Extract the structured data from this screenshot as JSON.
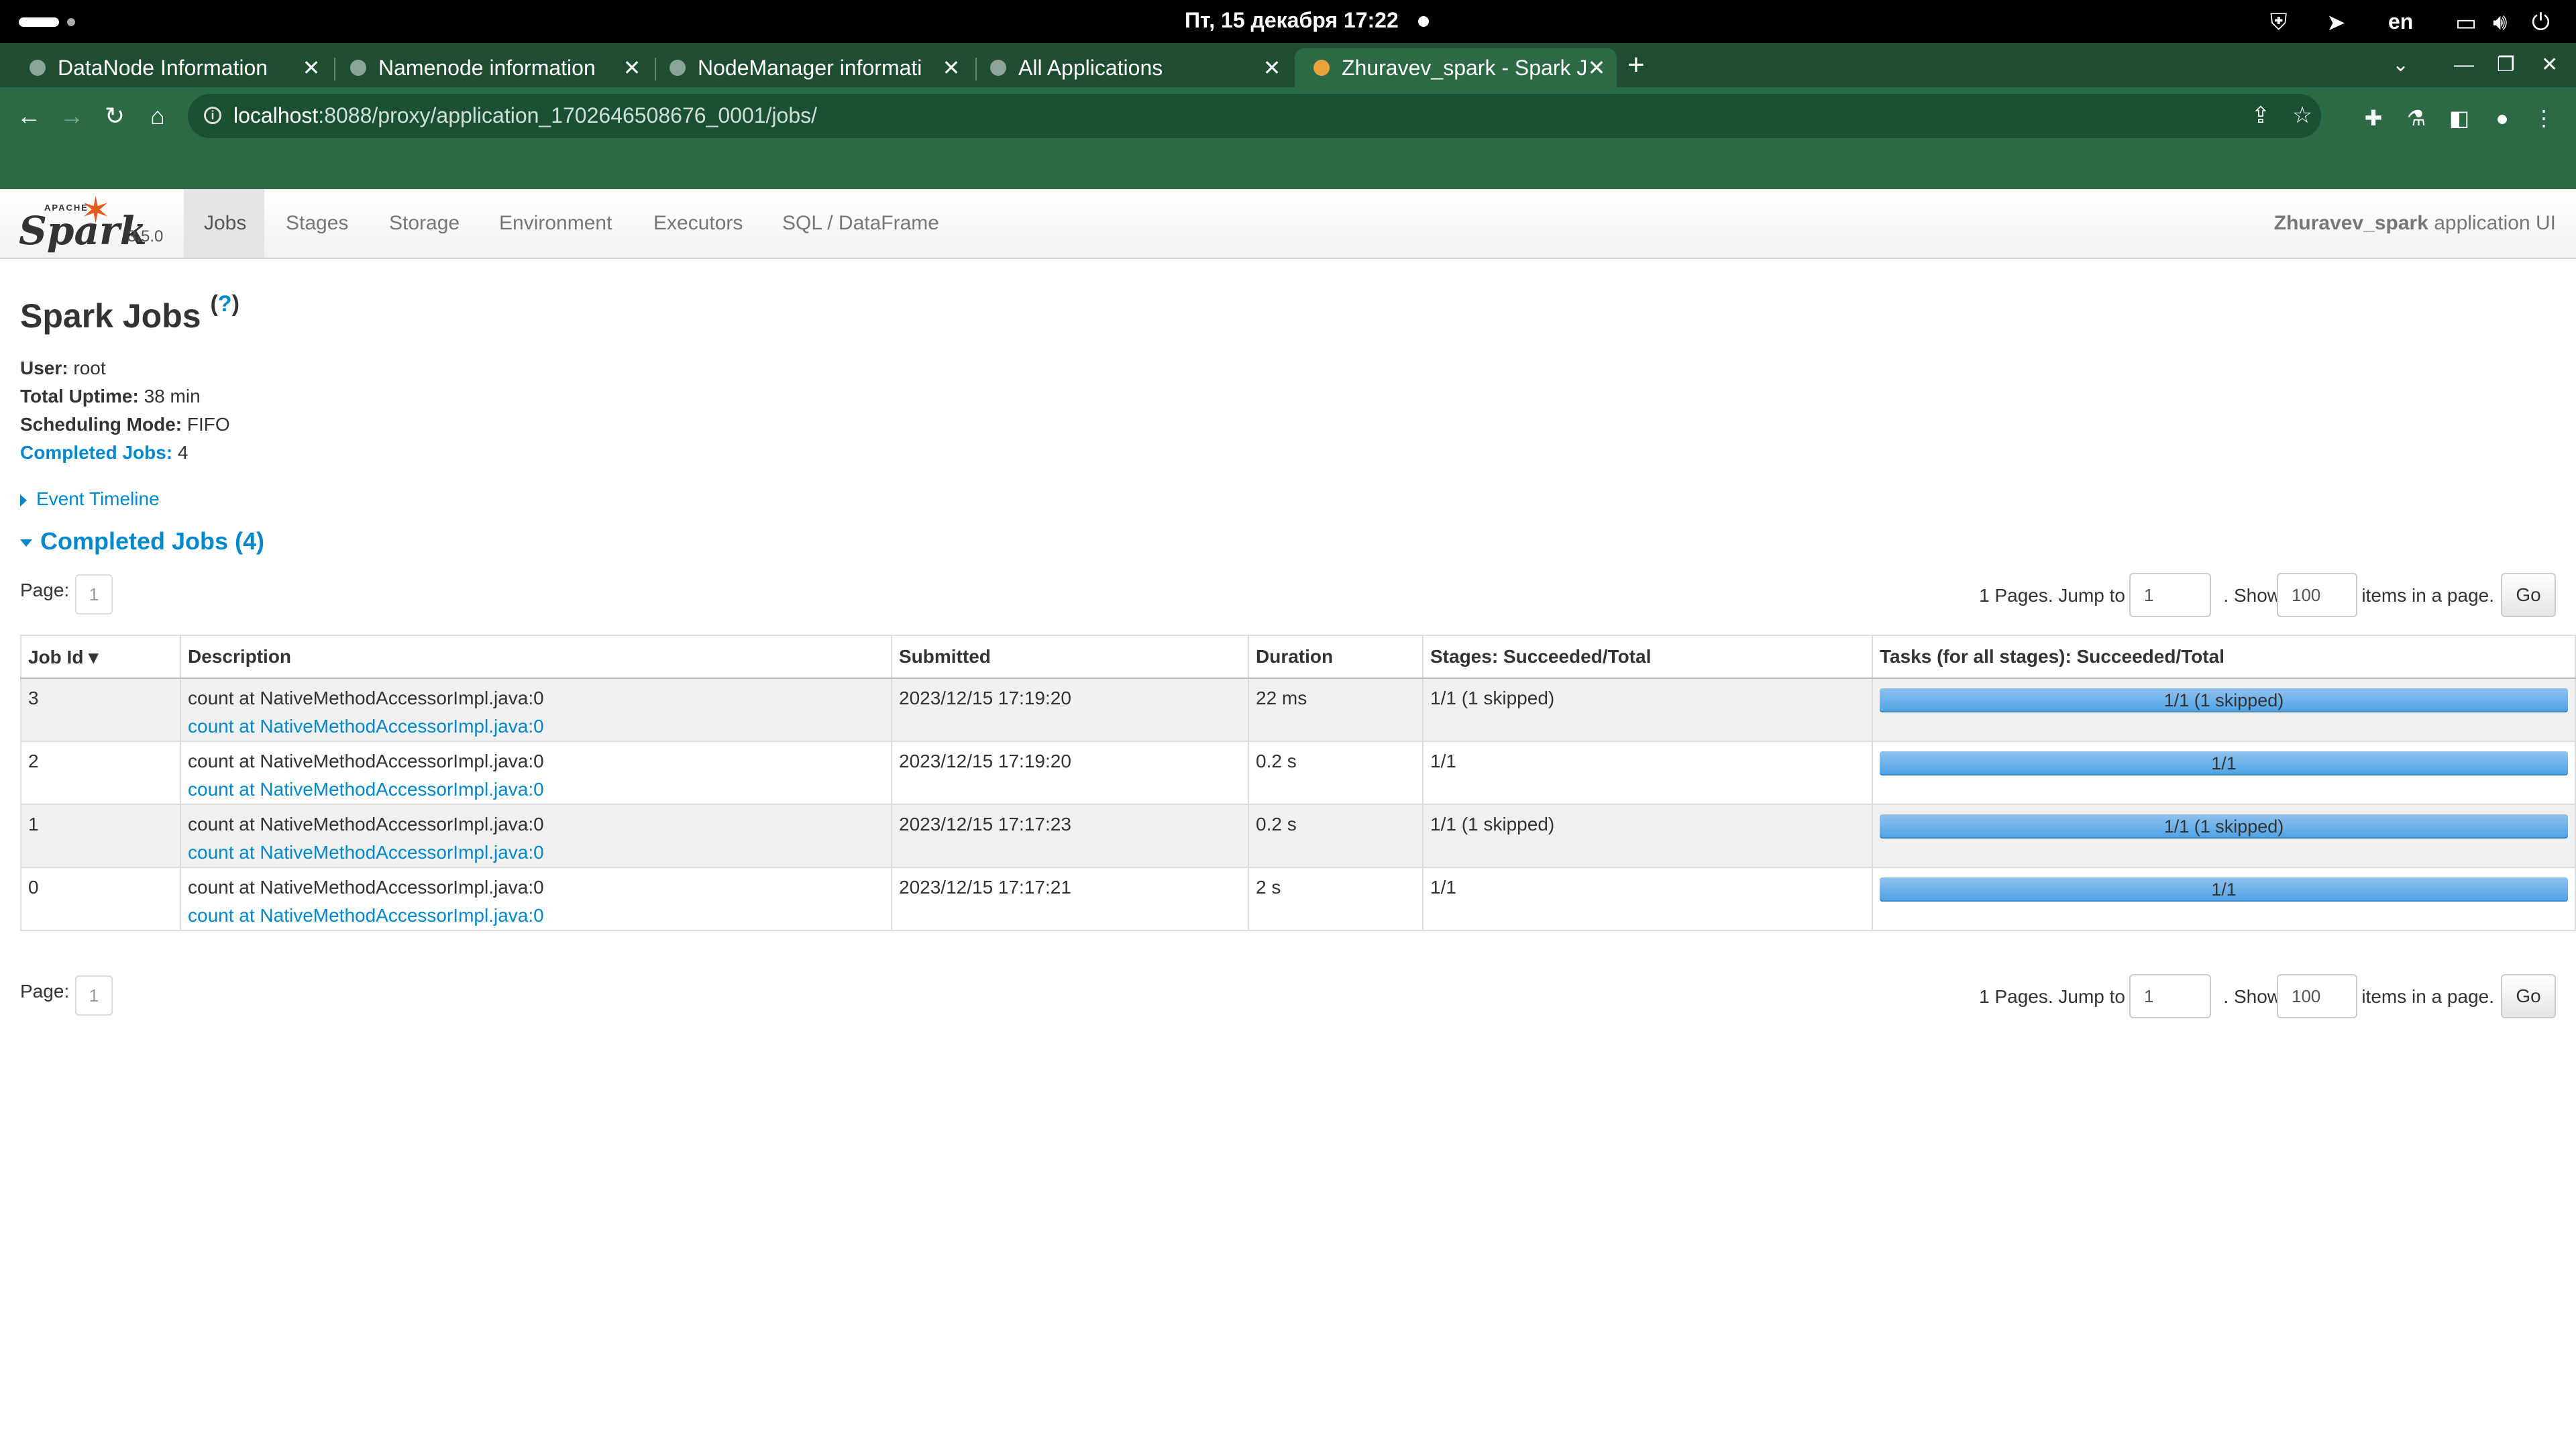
{
  "system_bar": {
    "clock": "Пт, 15 декабря  17:22",
    "lang": "en"
  },
  "browser": {
    "tabs": [
      {
        "title": "DataNode Information"
      },
      {
        "title": "Namenode information"
      },
      {
        "title": "NodeManager informati"
      },
      {
        "title": "All Applications"
      },
      {
        "title": "Zhuravev_spark - Spark J"
      }
    ],
    "url_host": "localhost",
    "url_rest": ":8088/proxy/application_1702646508676_0001/jobs/"
  },
  "spark_nav": {
    "logo_apache": "APACHE",
    "logo_word": "Spark",
    "version": "3.5.0",
    "items": [
      "Jobs",
      "Stages",
      "Storage",
      "Environment",
      "Executors",
      "SQL / DataFrame"
    ],
    "app_name": "Zhuravev_spark",
    "app_suffix": " application UI"
  },
  "page": {
    "title": "Spark Jobs",
    "help": "?",
    "user_label": "User:",
    "user": "root",
    "uptime_label": "Total Uptime:",
    "uptime": "38 min",
    "sched_label": "Scheduling Mode:",
    "sched": "FIFO",
    "completed_label": "Completed Jobs:",
    "completed": "4",
    "event_timeline": "Event Timeline",
    "completed_header": "Completed Jobs (4)"
  },
  "pager": {
    "page_label": "Page:",
    "current_page": "1",
    "pages_text": "1 Pages. Jump to",
    "jump_value": "1",
    "show_text": ". Show",
    "show_value": "100",
    "items_text": "items in a page.",
    "go": "Go"
  },
  "table": {
    "headers": [
      "Job Id ▾",
      "Description",
      "Submitted",
      "Duration",
      "Stages: Succeeded/Total",
      "Tasks (for all stages): Succeeded/Total"
    ],
    "rows": [
      {
        "id": "3",
        "desc": "count at NativeMethodAccessorImpl.java:0",
        "link": "count at NativeMethodAccessorImpl.java:0",
        "submitted": "2023/12/15 17:19:20",
        "duration": "22 ms",
        "stages": "1/1 (1 skipped)",
        "tasks": "1/1 (1 skipped)",
        "tasks_fraction": 1.0
      },
      {
        "id": "2",
        "desc": "count at NativeMethodAccessorImpl.java:0",
        "link": "count at NativeMethodAccessorImpl.java:0",
        "submitted": "2023/12/15 17:19:20",
        "duration": "0.2 s",
        "stages": "1/1",
        "tasks": "1/1",
        "tasks_fraction": 1.0
      },
      {
        "id": "1",
        "desc": "count at NativeMethodAccessorImpl.java:0",
        "link": "count at NativeMethodAccessorImpl.java:0",
        "submitted": "2023/12/15 17:17:23",
        "duration": "0.2 s",
        "stages": "1/1 (1 skipped)",
        "tasks": "1/1 (1 skipped)",
        "tasks_fraction": 1.0
      },
      {
        "id": "0",
        "desc": "count at NativeMethodAccessorImpl.java:0",
        "link": "count at NativeMethodAccessorImpl.java:0",
        "submitted": "2023/12/15 17:17:21",
        "duration": "2 s",
        "stages": "1/1",
        "tasks": "1/1",
        "tasks_fraction": 1.0
      }
    ]
  },
  "colors": {
    "browser_green": "#2b6a44",
    "link_blue": "#0088cc",
    "progress_blue": "#5aa9ea",
    "spark_orange": "#e25a1c"
  }
}
